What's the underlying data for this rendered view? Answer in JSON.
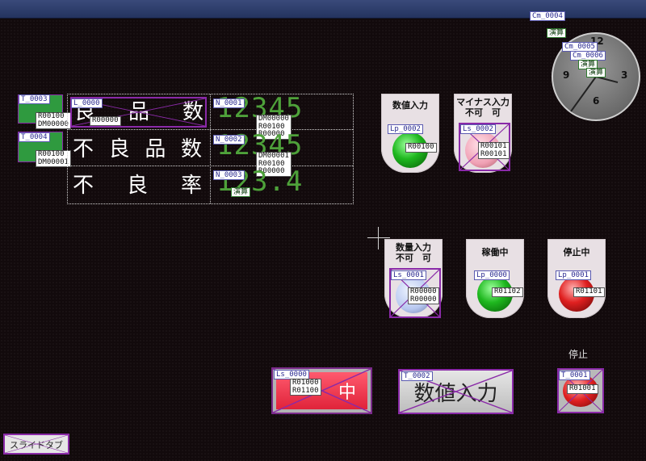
{
  "window": {
    "accent": "#2f3f70"
  },
  "clock": {
    "tags": [
      "Cm_0004",
      "Cm_0005",
      "Cm_0006"
    ],
    "calc_labels": [
      "演算",
      "演算",
      "演算"
    ],
    "numbers": {
      "n12": "12",
      "n3": "3",
      "n6": "6",
      "n9": "9"
    }
  },
  "table": {
    "rows": [
      {
        "label_chars": [
          "良",
          "品",
          "数"
        ],
        "value": "12345",
        "tag": "N_0001",
        "lamp_tag": "T_0003",
        "overlay_tag": "L_0000"
      },
      {
        "label_chars": [
          "不",
          "良",
          "品",
          "数"
        ],
        "value": "12345",
        "tag": "N_0002",
        "lamp_tag": "T_0004"
      },
      {
        "label_chars": [
          "不",
          "良",
          "率"
        ],
        "value": "123.4",
        "tag": "N_0003",
        "calc": "演算"
      }
    ],
    "addresses": {
      "t3": [
        "R00100",
        "DM00000"
      ],
      "t4": [
        "R00100",
        "DM00001"
      ],
      "l0": "R00000",
      "n1": [
        "DM00000",
        "R00100",
        "R00000"
      ],
      "n2": [
        "DM00001",
        "R00100",
        "R00000"
      ]
    }
  },
  "lamps": {
    "numeric_input": {
      "title": "数値入力",
      "tag": "Lp_0002",
      "addr": "R00100"
    },
    "minus_input": {
      "title1": "マイナス入力",
      "title2": "不可　可",
      "tag": "Ls_0002",
      "addr": [
        "R00101",
        "R00101"
      ]
    },
    "qty_input": {
      "title1": "数量入力",
      "title2": "不可　可",
      "tag": "Ls_0001",
      "addr": [
        "R00000",
        "R00000"
      ]
    },
    "running": {
      "title": "稼働中",
      "tag": "Lp_0000",
      "addr": "R01102"
    },
    "stopped": {
      "title": "停止中",
      "tag": "Lp_0001",
      "addr": "R01101"
    }
  },
  "buttons": {
    "run": {
      "tag": "Ls_0000",
      "addr": [
        "R01000",
        "R01100"
      ],
      "label": "中"
    },
    "numeric": {
      "tag": "T_0002",
      "label": "数値入力"
    },
    "stop": {
      "caption": "停止",
      "tag": "T_0001",
      "addr": "R01001"
    },
    "slide_tab": {
      "label": "スライドタブ"
    }
  }
}
